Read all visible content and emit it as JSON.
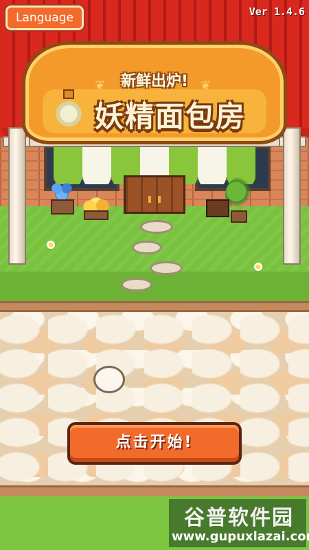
{
  "top_bar": {
    "language_label": "Language",
    "version": "Ver 1.4.6"
  },
  "logo": {
    "subtitle": "新鲜出炉!",
    "title": "妖精面包房"
  },
  "start": {
    "label": "点击开始!"
  },
  "watermark": {
    "brand": "谷普软件园",
    "url": "www.gupuxlazai.com"
  },
  "colors": {
    "button_orange": "#f26b2a",
    "roof_red": "#d9281e",
    "sign_orange": "#f39a2a",
    "grass_green": "#7cc640",
    "awning_green": "#8ac63c"
  },
  "icons": [
    "bottle-icon",
    "wheat-icon"
  ]
}
